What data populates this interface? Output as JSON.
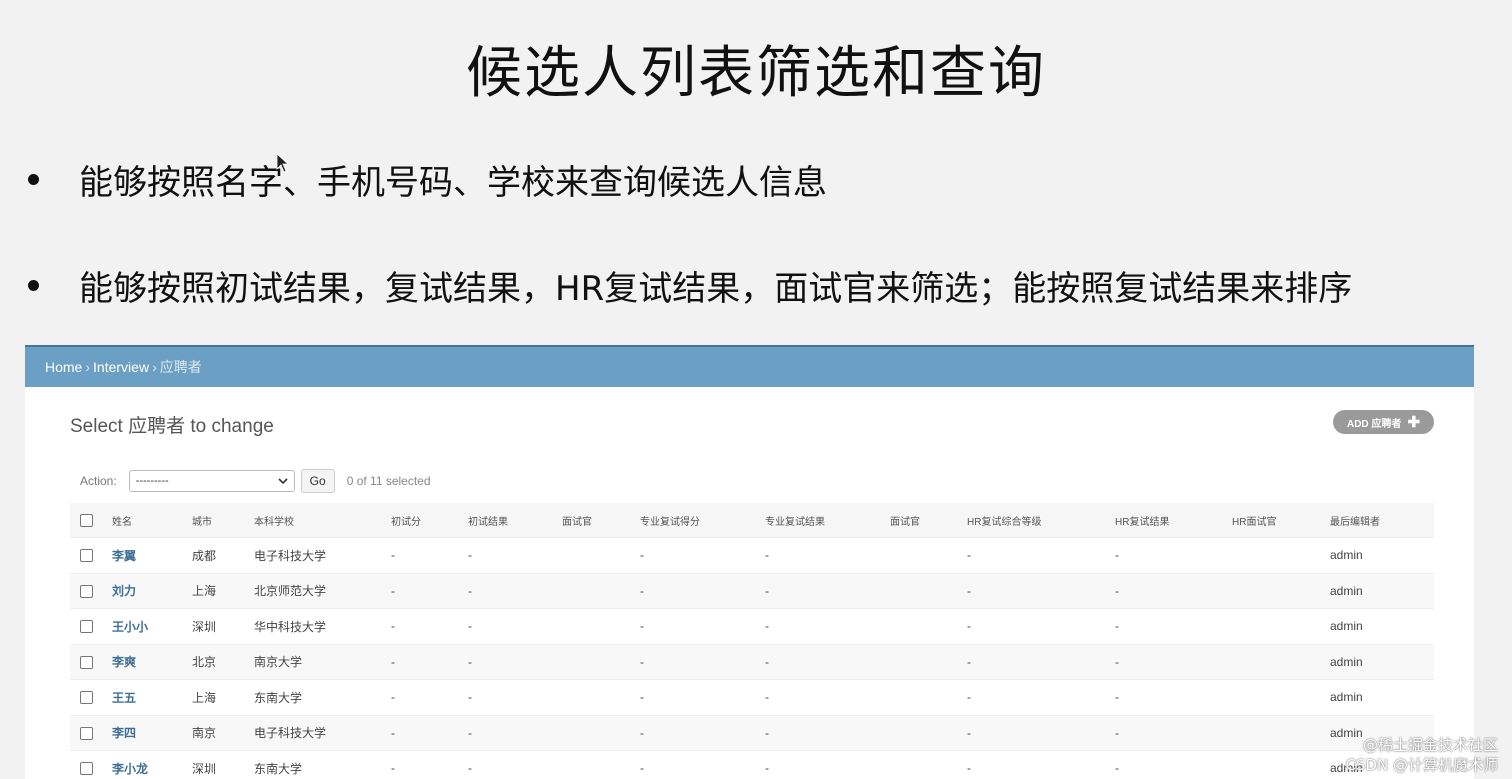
{
  "slide": {
    "title": "候选人列表筛选和查询",
    "bullets": [
      "能够按照名字、手机号码、学校来查询候选人信息",
      "能够按照初试结果，复试结果，HR复试结果，面试官来筛选；能按照复试结果来排序"
    ]
  },
  "breadcrumb": {
    "home": "Home",
    "section": "Interview",
    "current": "应聘者",
    "separator": "›"
  },
  "page_heading": "Select 应聘者 to change",
  "add_button": {
    "label": "ADD 应聘者",
    "icon": "plus-icon"
  },
  "actions": {
    "label": "Action:",
    "selected": "---------",
    "go_label": "Go",
    "counter": "0 of 11 selected"
  },
  "table": {
    "headers": [
      "姓名",
      "城市",
      "本科学校",
      "初试分",
      "初试结果",
      "面试官",
      "专业复试得分",
      "专业复试结果",
      "面试官",
      "HR复试综合等级",
      "HR复试结果",
      "HR面试官",
      "最后编辑者"
    ],
    "rows": [
      [
        "李翼",
        "成都",
        "电子科技大学",
        "-",
        "-",
        "",
        "-",
        "-",
        "",
        "-",
        "-",
        "",
        "admin"
      ],
      [
        "刘力",
        "上海",
        "北京师范大学",
        "-",
        "-",
        "",
        "-",
        "-",
        "",
        "-",
        "-",
        "",
        "admin"
      ],
      [
        "王小小",
        "深圳",
        "华中科技大学",
        "-",
        "-",
        "",
        "-",
        "-",
        "",
        "-",
        "-",
        "",
        "admin"
      ],
      [
        "李爽",
        "北京",
        "南京大学",
        "-",
        "-",
        "",
        "-",
        "-",
        "",
        "-",
        "-",
        "",
        "admin"
      ],
      [
        "王五",
        "上海",
        "东南大学",
        "-",
        "-",
        "",
        "-",
        "-",
        "",
        "-",
        "-",
        "",
        "admin"
      ],
      [
        "李四",
        "南京",
        "电子科技大学",
        "-",
        "-",
        "",
        "-",
        "-",
        "",
        "-",
        "-",
        "",
        "admin"
      ],
      [
        "李小龙",
        "深圳",
        "东南大学",
        "-",
        "-",
        "",
        "-",
        "-",
        "",
        "-",
        "-",
        "",
        "admin"
      ]
    ]
  },
  "watermark": {
    "line1": "@稀土掘金技术社区",
    "line2": "CSDN @计算机魔术师"
  },
  "colors": {
    "breadcrumb_bar": "#6b9fc4",
    "link": "#3f6f96",
    "add_button": "#9a9a9a"
  }
}
